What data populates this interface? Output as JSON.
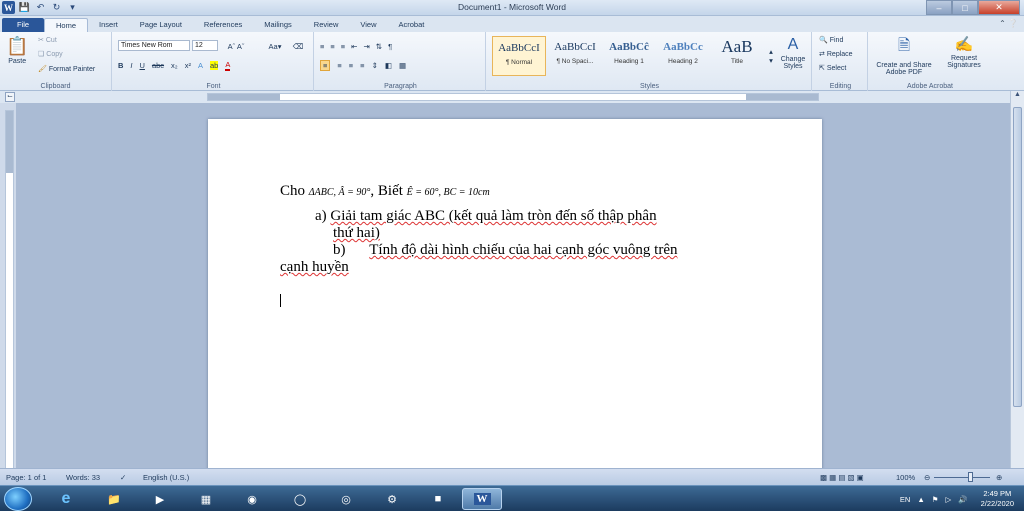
{
  "window": {
    "title": "Document1 - Microsoft Word"
  },
  "tabs": [
    "File",
    "Home",
    "Insert",
    "Page Layout",
    "References",
    "Mailings",
    "Review",
    "View",
    "Acrobat"
  ],
  "ribbon": {
    "clipboard": {
      "paste": "Paste",
      "cut": "Cut",
      "copy": "Copy",
      "format_painter": "Format Painter",
      "label": "Clipboard"
    },
    "font": {
      "name": "Times New Rom",
      "size": "12",
      "label": "Font"
    },
    "paragraph": {
      "label": "Paragraph"
    },
    "styles": {
      "items": [
        {
          "preview": "AaBbCcI",
          "name": "¶ Normal"
        },
        {
          "preview": "AaBbCcI",
          "name": "¶ No Spaci..."
        },
        {
          "preview": "AaBbCĉ",
          "name": "Heading 1"
        },
        {
          "preview": "AaBbCc",
          "name": "Heading 2"
        },
        {
          "preview": "AaB",
          "name": "Title"
        }
      ],
      "change_styles": "Change Styles",
      "label": "Styles"
    },
    "editing": {
      "find": "Find",
      "replace": "Replace",
      "select": "Select",
      "label": "Editing"
    },
    "acrobat": {
      "create": "Create and Share Adobe PDF",
      "request": "Request Signatures",
      "label": "Adobe Acrobat"
    }
  },
  "document": {
    "line1_prefix": "Cho",
    "line1_math1": "ΔABC,  Â = 90°",
    "line1_mid": ", Biết",
    "line1_math2": "Ê = 60°,  BC = 10cm",
    "item_a_label": "a)",
    "item_a_text1": "Giải tam giác ABC (kết quả làm tròn đến số thập phân",
    "item_a_text2": "thứ hai)",
    "item_b_label": "b)",
    "item_b_text1": "Tính độ dài hình chiếu của hai cạnh góc vuông trên",
    "item_b_text2": "cạnh huyền"
  },
  "status": {
    "page": "Page: 1 of 1",
    "words": "Words: 33",
    "language": "English (U.S.)",
    "zoom": "100%"
  },
  "taskbar": {
    "lang": "EN",
    "time": "2:49 PM",
    "date": "2/22/2020"
  }
}
